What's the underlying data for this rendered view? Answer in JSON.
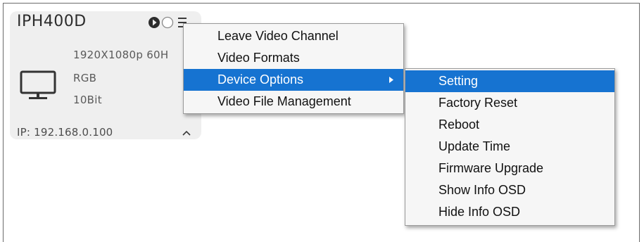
{
  "device": {
    "name": "IPH400D",
    "resolution": "1920X1080p 60H",
    "color_space": "RGB",
    "bit_depth": "10Bit",
    "ip": "IP: 192.168.0.100"
  },
  "icons": {
    "play": "play-icon",
    "status": "circle-icon",
    "menu": "hamburger-menu-icon",
    "display": "monitor-icon",
    "collapse": "chevron-up-icon",
    "submenu": "arrow-right-icon"
  },
  "main_menu": {
    "items": [
      {
        "label": "Leave Video Channel"
      },
      {
        "label": "Video Formats"
      },
      {
        "label": "Device Options"
      },
      {
        "label": "Video File Management"
      }
    ],
    "active": "Device Options"
  },
  "sub_menu": {
    "items": [
      {
        "label": "Setting"
      },
      {
        "label": "Factory Reset"
      },
      {
        "label": "Reboot"
      },
      {
        "label": "Update Time"
      },
      {
        "label": "Firmware Upgrade"
      },
      {
        "label": "Show Info OSD"
      },
      {
        "label": "Hide Info OSD"
      }
    ],
    "active": "Setting"
  },
  "colors": {
    "highlight": "#1673d1",
    "card_background": "#efefef"
  }
}
